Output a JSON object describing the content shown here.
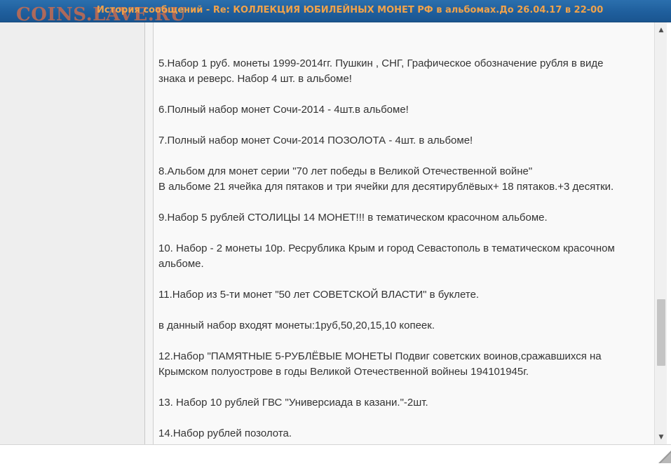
{
  "window": {
    "watermark": "COINS.LAVE.RU",
    "title": "История сообщений - Re: КОЛЛЕКЦИЯ ЮБИЛЕЙНЫХ МОНЕТ РФ в альбомах.До 26.04.17 в 22-00",
    "title_color": "#f0a24a",
    "titlebar_color": "#1f5f9d"
  },
  "messages": [
    {
      "lines": [
        "5.Набор 1 руб. монеты 1999-2014гг. Пушкин , СНГ, Графическое обозначение рубля в виде",
        "знака и реверс. Набор 4 шт. в альбоме!"
      ]
    },
    {
      "lines": [
        "6.Полный набор монет Сочи-2014 - 4шт.в альбоме!"
      ]
    },
    {
      "lines": [
        "7.Полный набор монет Сочи-2014 ПОЗОЛОТА - 4шт. в альбоме!"
      ]
    },
    {
      "lines": [
        "8.Альбом для монет серии \"70 лет победы в Великой Отечественной войне\"",
        "В альбоме 21 ячейка для пятаков и три ячейки для десятирублёвых+ 18 пятаков.+3 десятки."
      ]
    },
    {
      "lines": [
        "9.Набор 5 рублей СТОЛИЦЫ 14 МОНЕТ!!! в тематическом красочном альбоме."
      ]
    },
    {
      "lines": [
        "10. Набор - 2 монеты 10р. Ресрублика Крым и город Севастополь в тематическом красочном",
        "альбоме."
      ]
    },
    {
      "lines": [
        "11.Набор из 5-ти монет \"50 лет СОВЕТСКОЙ ВЛАСТИ\" в буклете."
      ]
    },
    {
      "lines": [
        "в данный набор входят монеты:1руб,50,20,15,10 копеек."
      ]
    },
    {
      "lines": [
        "12.Набор \"ПАМЯТНЫЕ 5-РУБЛЁВЫЕ МОНЕТЫ Подвиг советских воинов,сражавшихся на",
        "Крымском полуострове в годы Великой Отечественной войнеы 194101945г."
      ]
    },
    {
      "lines": [
        "13. Набор 10 рублей ГВС \"Универсиада в казани.\"-2шт."
      ]
    },
    {
      "lines": [
        "14.Набор рублей позолота."
      ]
    }
  ],
  "scrollbar": {
    "up_icon": "arrow-up-icon",
    "down_icon": "arrow-down-icon",
    "position_fraction": 0.82
  },
  "footer": {
    "grip_icon": "resize-grip-icon"
  }
}
